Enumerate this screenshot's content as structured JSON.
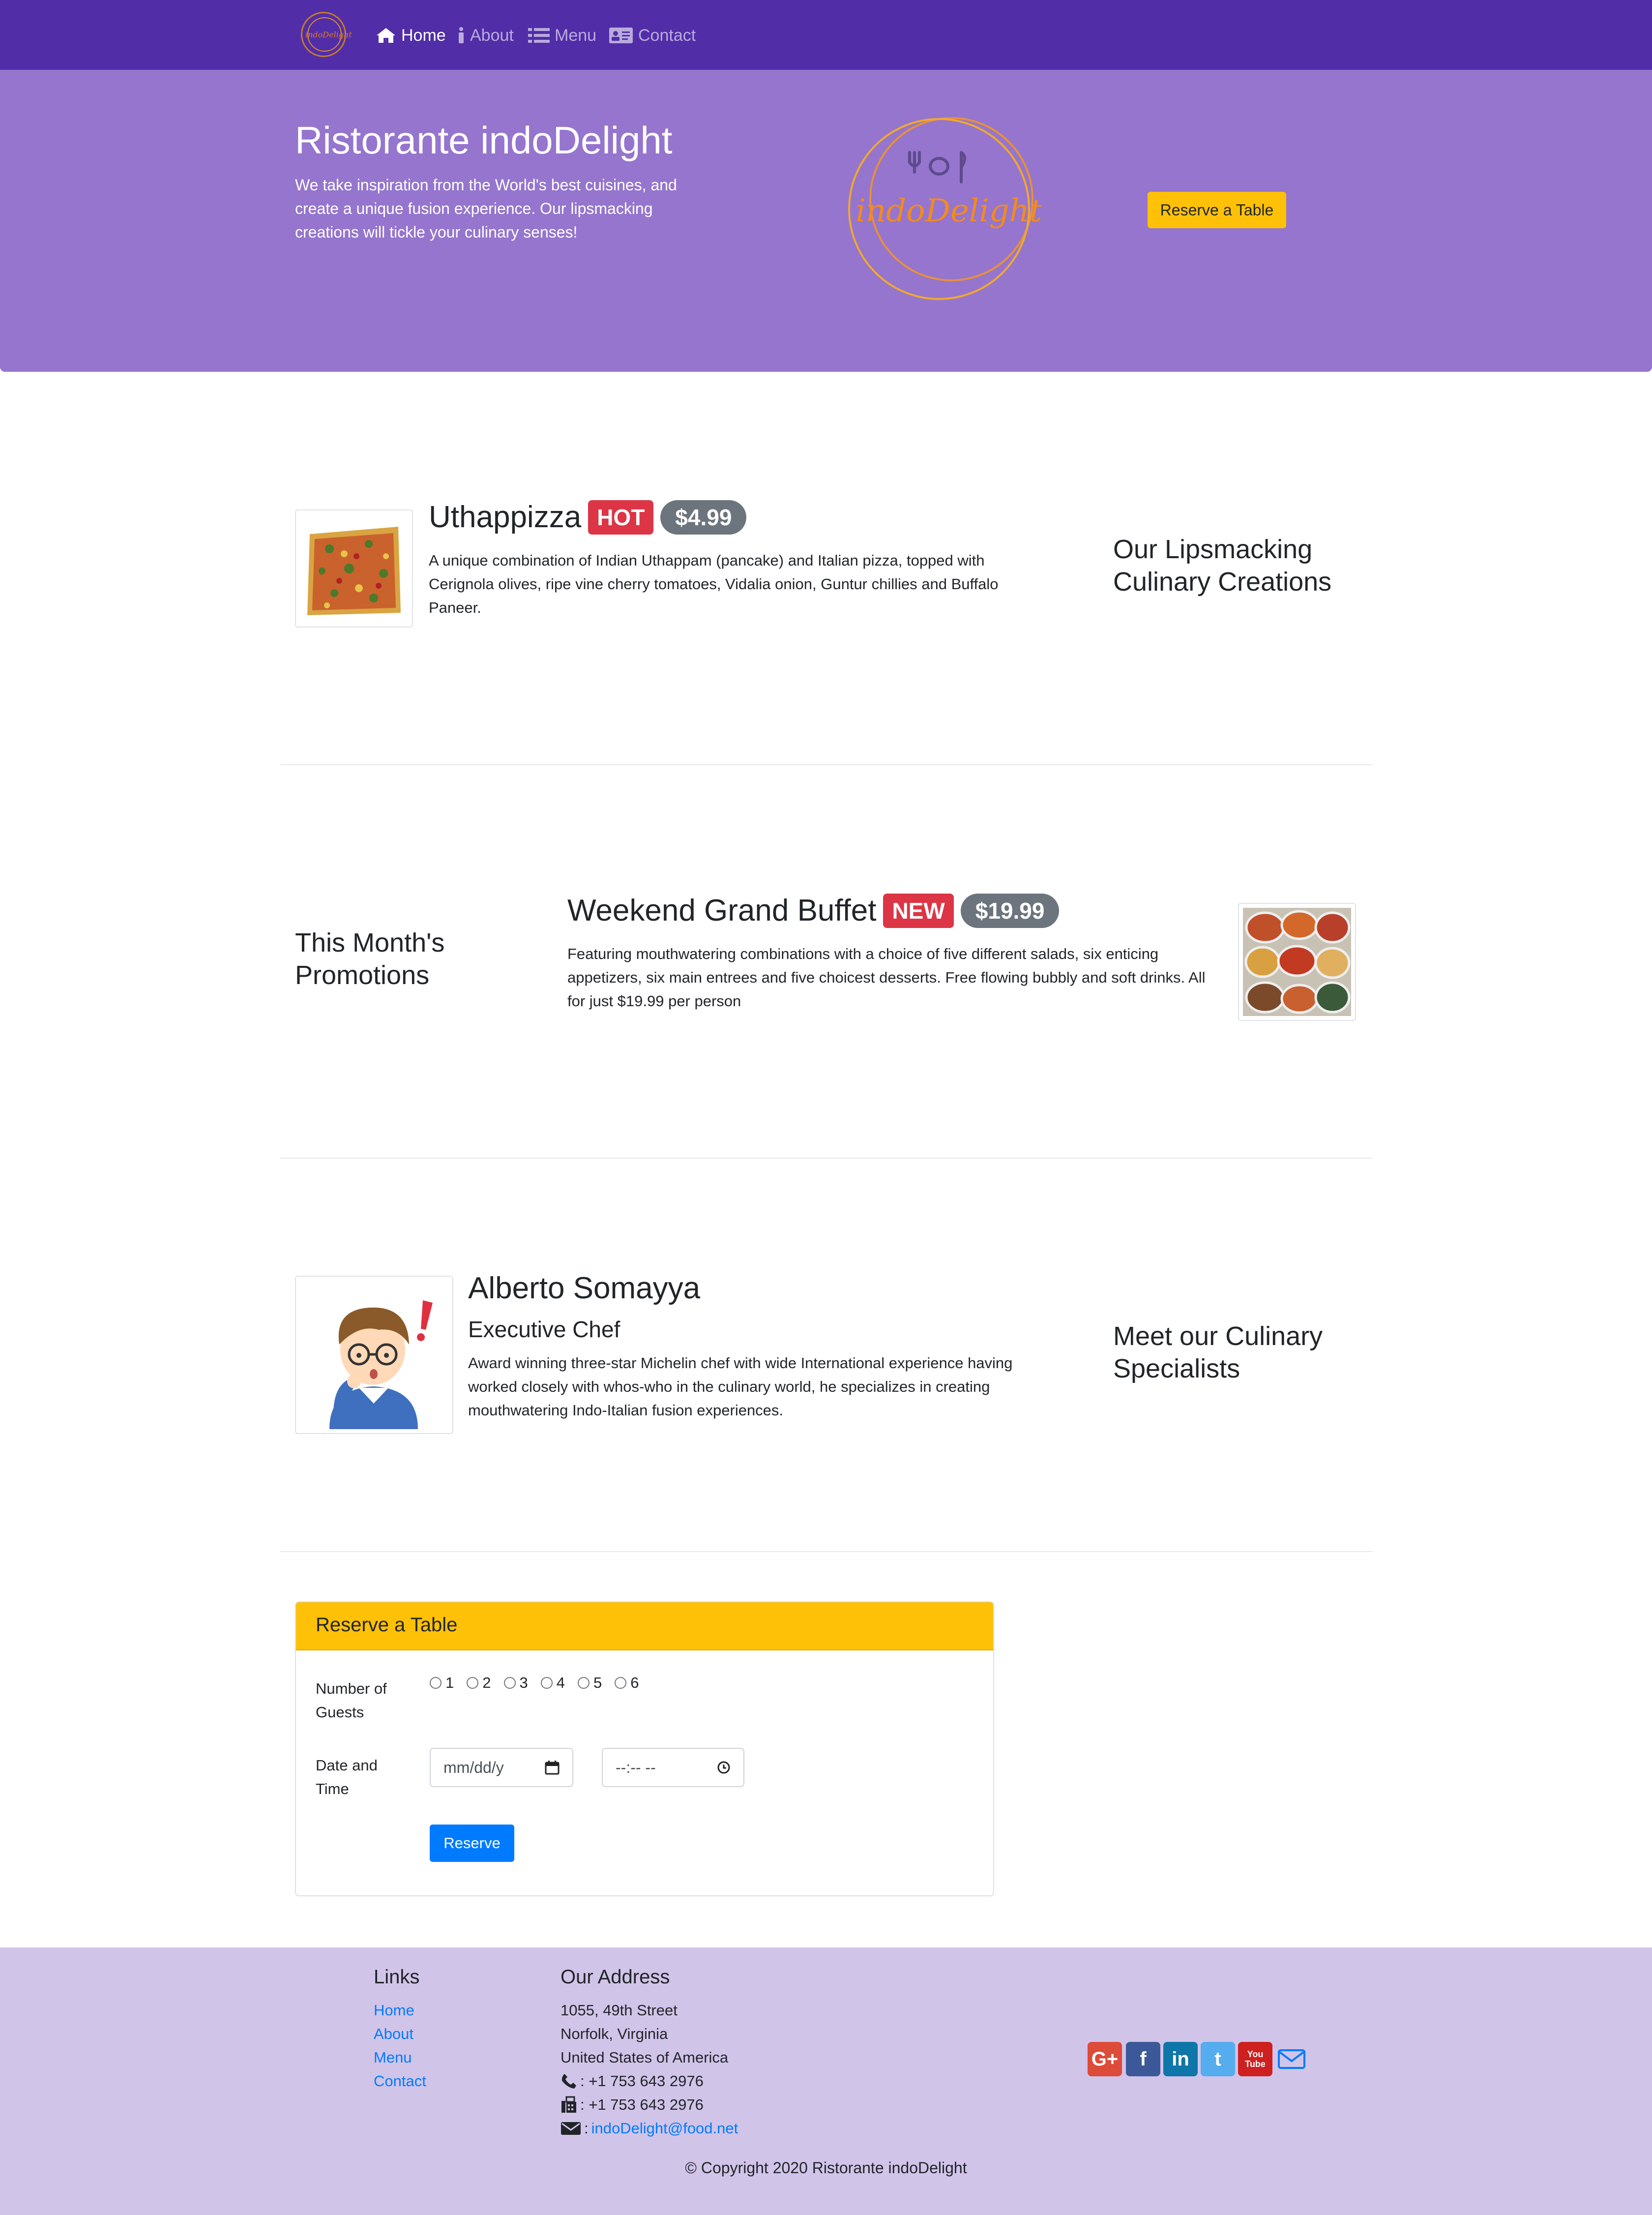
{
  "nav": {
    "logo_text": "indoDelight",
    "items": [
      {
        "label": "Home",
        "icon": "home-icon"
      },
      {
        "label": "About",
        "icon": "info-icon"
      },
      {
        "label": "Menu",
        "icon": "list-icon"
      },
      {
        "label": "Contact",
        "icon": "address-card-icon"
      }
    ]
  },
  "jumbotron": {
    "title": "Ristorante indoDelight",
    "text": "We take inspiration from the World's best cuisines, and create a unique fusion experience. Our lipsmacking creations will tickle your culinary senses!",
    "logo_text": "indoDelight",
    "reserve_button": "Reserve a Table"
  },
  "dish": {
    "name": "Uthappizza",
    "badge": "HOT",
    "price": "$4.99",
    "description": "A unique combination of Indian Uthappam (pancake) and Italian pizza, topped with Cerignola olives, ripe vine cherry tomatoes, Vidalia onion, Guntur chillies and Buffalo Paneer.",
    "side_heading": "Our Lipsmacking Culinary Creations"
  },
  "promotion": {
    "side_heading": "This Month's Promotions",
    "name": "Weekend Grand Buffet",
    "badge": "NEW",
    "price": "$19.99",
    "description": "Featuring mouthwatering combinations with a choice of five different salads, six enticing appetizers, six main entrees and five choicest desserts. Free flowing bubbly and soft drinks. All for just $19.99 per person"
  },
  "leader": {
    "name": "Alberto Somayya",
    "role": "Executive Chef",
    "description": "Award winning three-star Michelin chef with wide International experience having worked closely with whos-who in the culinary world, he specializes in creating mouthwatering Indo-Italian fusion experiences.",
    "side_heading": "Meet our Culinary Specialists"
  },
  "reservation": {
    "header": "Reserve a Table",
    "guests_label": "Number of Guests",
    "guest_options": [
      "1",
      "2",
      "3",
      "4",
      "5",
      "6"
    ],
    "datetime_label": "Date and Time",
    "date_placeholder": "mm/dd/y",
    "time_placeholder": "--:-- --",
    "submit": "Reserve"
  },
  "footer": {
    "links_heading": "Links",
    "links": [
      "Home",
      "About",
      "Menu",
      "Contact"
    ],
    "address_heading": "Our Address",
    "address_lines": [
      "1055, 49th Street",
      "Norfolk, Virginia",
      "United States of America"
    ],
    "phone": ": +1 753 643 2976",
    "fax": ": +1 753 643 2976",
    "email": "indoDelight@food.net",
    "social": [
      {
        "icon": "google-plus-icon",
        "label": "G+",
        "color": "#dd4b39"
      },
      {
        "icon": "facebook-icon",
        "label": "f",
        "color": "#3b5998"
      },
      {
        "icon": "linkedin-icon",
        "label": "in",
        "color": "#0e76a8"
      },
      {
        "icon": "twitter-icon",
        "label": "t",
        "color": "#55acee"
      },
      {
        "icon": "youtube-icon",
        "label": "You Tube",
        "color": "#cd201f"
      }
    ],
    "copyright": "© Copyright 2020 Ristorante indoDelight"
  },
  "colors": {
    "navbar": "#512da8",
    "jumbotron": "#9575cd",
    "footer": "#d1c4e9",
    "warning": "#ffc107",
    "primary": "#007bff",
    "danger": "#dc3545",
    "secondary": "#6c757d"
  }
}
